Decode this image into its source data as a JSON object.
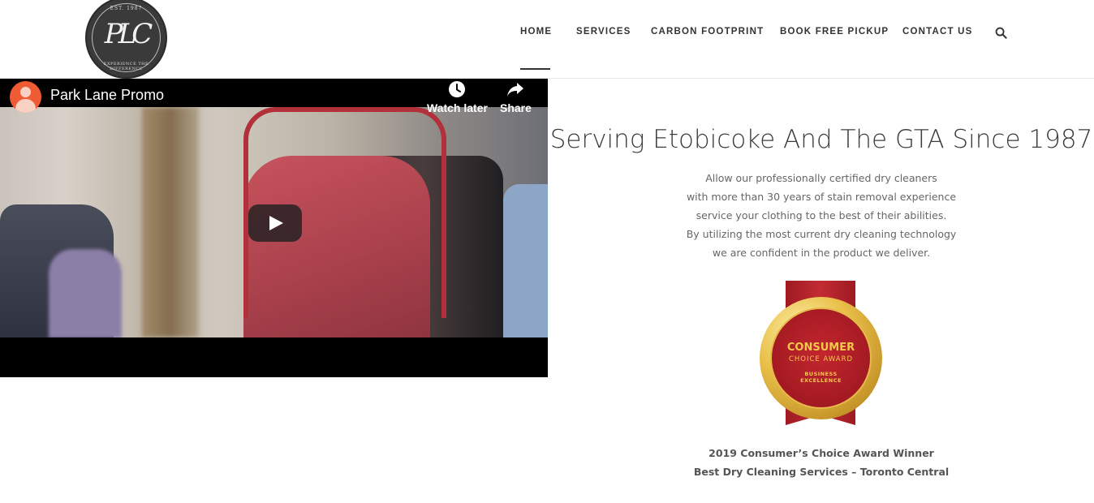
{
  "logo": {
    "monogram": "PLC",
    "est": "EST. 1987",
    "tagline": "EXPERIENCE THE DIFFERENCE"
  },
  "nav": {
    "items": [
      {
        "label": "HOME",
        "active": true
      },
      {
        "label": "SERVICES",
        "active": false
      },
      {
        "label": "CARBON FOOTPRINT",
        "active": false
      },
      {
        "label": "BOOK FREE PICKUP",
        "active": false
      },
      {
        "label": "CONTACT US",
        "active": false
      }
    ],
    "search_icon": "search-icon"
  },
  "video": {
    "title": "Park Lane Promo",
    "watch_later": "Watch later",
    "share": "Share",
    "play_icon": "play-icon"
  },
  "main": {
    "heading": "Serving Etobicoke And The GTA Since 1987",
    "description": [
      "Allow our professionally certified dry cleaners",
      "with more than 30 years of stain removal experience",
      "service your clothing to the best of their abilities.",
      "By utilizing the most current dry cleaning technology",
      "we are confident in the product we deliver."
    ],
    "award": {
      "line1": "CONSUMER",
      "line2": "CHOICE AWARD",
      "line3": "BUSINESS",
      "line4": "EXCELLENCE"
    },
    "caption": [
      "2019 Consumer’s Choice Award Winner",
      "Best Dry Cleaning Services – Toronto Central"
    ]
  },
  "colors": {
    "nav_text": "#333333",
    "ribbon_red": "#c32b33",
    "medal_gold": "#e9c04a",
    "avatar_orange": "#ef5b34"
  }
}
